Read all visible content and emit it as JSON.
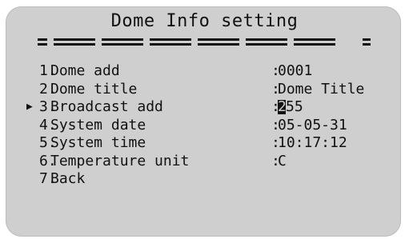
{
  "screen": {
    "title": "Dome Info setting",
    "cursor_symbol": "▶",
    "items": [
      {
        "num": "1.",
        "label": "Dome add",
        "colon": ":",
        "value": "0001"
      },
      {
        "num": "2.",
        "label": "Dome title",
        "colon": ":",
        "value": "Dome Title"
      },
      {
        "num": "3.",
        "label": "Broadcast add",
        "colon": ":",
        "value_highlight": "2",
        "value_rest": "55"
      },
      {
        "num": "4.",
        "label": "System date",
        "colon": ":",
        "value": "05-05-31"
      },
      {
        "num": "5.",
        "label": "System time",
        "colon": ":",
        "value": "10:17:12"
      },
      {
        "num": "6.",
        "label": "Temperature unit",
        "colon": ":",
        "value": "C"
      },
      {
        "num": "7.",
        "label": "Back"
      }
    ],
    "colors": {
      "panel": "#cfcfcf",
      "text": "#111111"
    }
  }
}
